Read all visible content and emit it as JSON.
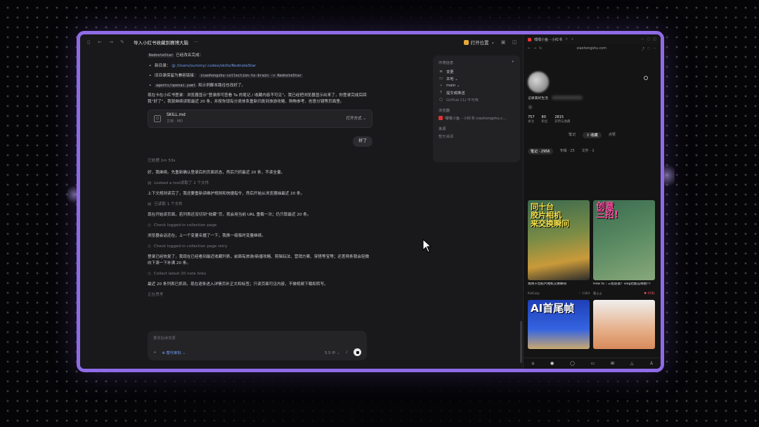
{
  "left_panel": {
    "topbar": {
      "title": "导入小红书收藏到赛博大脑",
      "more": "···",
      "open_btn": "打开位置"
    },
    "intro": "已经改名完成：",
    "intro_code": "RednoteStar",
    "bullets": [
      {
        "label": "新目录：",
        "link": "/Users/summy/.codex/skills/RednoteStar"
      },
      {
        "label": "旧目录保留为兼容链接：",
        "code": "xiaohongshu-collection-to-brain -> RednoteStar"
      },
      {
        "code": "agents/openai.yaml",
        "label": "和示例脚本路径也改好了。"
      }
    ],
    "para1": "现在卡在小红书登录：浏览器显示“登录即可查看 Ta 的笔记 / 收藏内容不可见”。我已经把浏览器显示出来了，你登录完成后回我“好了”，我就继续读取最近 20 条，并按你现有分类体系重新归类到旅游攻略、购物参考、创意分镜等页面里。",
    "file": {
      "name": "SKILL.md",
      "meta": "文档 · MD",
      "open_as": "打开方式 ⌄"
    },
    "user_reply": "好了",
    "processed": "已处理 1m 53s",
    "msg1": "好，我继续。先重新确认登录后的页面状态，然后只抓最近 20 条，不读全量。",
    "tool1": "Looked a tool读取了 2 个文件",
    "msg2": "上下文规则读完了，我还要重新读维护规则和快捷指令，然后开始从浏览器抽最近 20 条。",
    "tool2": "已读取 1 个文件",
    "msg3": "现在开始读页面，若列表还没切到“收藏”页，我会用当前 URL 重载一次；仍只取最近 20 条。",
    "tool3": "Check logged-in collection page",
    "msg4": "浏览器会话还在，上一个变量名撞了一下，我换一组临时变量继续。",
    "tool4": "Check logged-in collection page retry",
    "msg5": "登录已经恢复了，我现在已经看到最近收藏列表，前面有旅游/新疆攻略、剪辑玩法、营销方案、穿搭等宝等；还差两条我会轻微向下滚一下补满 20 条。",
    "tool5": "Collect latest 20 note links",
    "msg6": "最近 20 条列表已抓到。现在逐条进入详情页补正文和标签；只读页面可见内容，不做视频下载和转写。",
    "thinking": "正在思考",
    "composer": {
      "placeholder": "要求后续变更",
      "permission": "⊕ 替代审批 ⌄",
      "model": "5.5 中 ⌄"
    }
  },
  "env_panel": {
    "title": "环境信息",
    "add": "+",
    "rows": [
      {
        "icon": "changes-icon",
        "sym": "≡",
        "label": "变更"
      },
      {
        "icon": "local-icon",
        "sym": "▭",
        "label": "本地 ⌄"
      },
      {
        "icon": "branch-icon",
        "sym": "⑂",
        "label": "main ⌄"
      },
      {
        "icon": "commit-icon",
        "sym": "↑",
        "label": "提交或推送"
      },
      {
        "icon": "github-icon",
        "sym": "○",
        "label": "GitHub CLI 不可用"
      }
    ],
    "browser_section": "浏览器",
    "browser_item": "嘿嘿小鱼 - 小红书   ciaohongshu.c...",
    "source_section": "来源",
    "source_empty": "暂无来源"
  },
  "browser": {
    "tab_title": "嘿嘿小鱼 - 小红书",
    "url": "xiaohongshu.com",
    "bio": "记录美好生活",
    "stats": [
      {
        "value": "757",
        "label": "关注"
      },
      {
        "value": "80",
        "label": "粉丝"
      },
      {
        "value": "2815",
        "label": "获赞与收藏"
      }
    ],
    "profile_tabs": [
      "笔记",
      "⇧ 收藏",
      "点赞"
    ],
    "sub_tabs": [
      "笔记 · 2956",
      "专辑 · 25",
      "文件 · 1"
    ],
    "cards": [
      {
        "overlay": "同十台\n胶片相机\n来交换瞬间",
        "caption": "我用十台胶片相机交换瞬间",
        "author": "KidCozy",
        "likes": "♡ 1364"
      },
      {
        "overlay": "创意\n三招!",
        "caption": "How to｜三招逆袭！vlog也能这样拍!!!",
        "author": "曹士士",
        "likes": "♥ 4781"
      },
      {
        "overlay": "AI首尾帧",
        "caption": "",
        "author": "",
        "likes": ""
      },
      {
        "overlay": "",
        "caption": "",
        "author": "",
        "likes": ""
      }
    ]
  }
}
